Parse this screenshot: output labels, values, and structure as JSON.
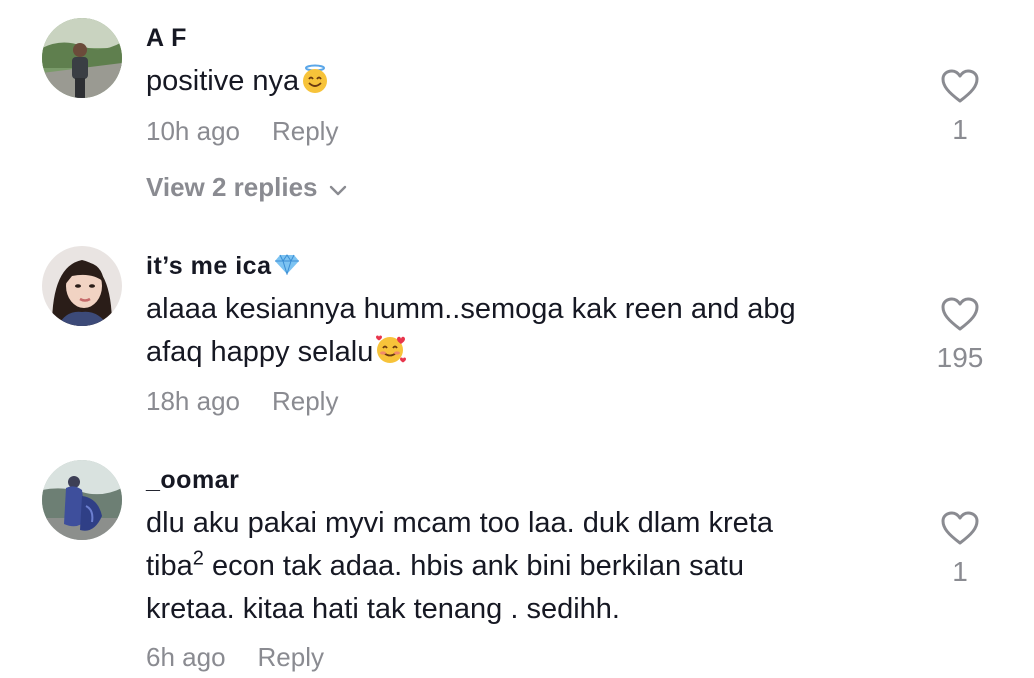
{
  "comments": [
    {
      "username": "A F",
      "text": "positive nya",
      "emoji": "halo-smile-emoji",
      "time": "10h ago",
      "reply_label": "Reply",
      "likes": "1",
      "view_replies": "View 2 replies"
    },
    {
      "username": "it’s me ica",
      "username_emoji": "gem-emoji",
      "text_line1": "alaaa kesiannya humm..semoga kak reen and abg",
      "text_line2": "afaq happy selalu",
      "emoji": "smiling-face-with-hearts-emoji",
      "time": "18h ago",
      "reply_label": "Reply",
      "likes": "195"
    },
    {
      "username": "_oomar",
      "text_line1": "dlu aku pakai myvi mcam too laa. duk dlam kreta",
      "text_line2_a": "tiba",
      "text_line2_sup": "2",
      "text_line2_b": " econ tak adaa. hbis ank bini berkilan satu",
      "text_line3": "kretaa. kitaa hati tak tenang . sedihh.",
      "time": "6h ago",
      "reply_label": "Reply",
      "likes": "1"
    }
  ],
  "colors": {
    "primary_text": "#161823",
    "secondary_text": "#8a8b91",
    "background": "#ffffff"
  }
}
